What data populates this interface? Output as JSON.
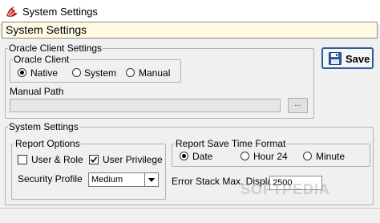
{
  "window": {
    "title": "System Settings",
    "icon": "app-logo-icon"
  },
  "caption": "System Settings",
  "save_button": {
    "label": "Save",
    "icon": "floppy-disk-icon"
  },
  "oracle_client_settings": {
    "legend": "Oracle Client Settings",
    "oracle_client": {
      "legend": "Oracle Client",
      "options": [
        {
          "label": "Native",
          "selected": true
        },
        {
          "label": "System",
          "selected": false
        },
        {
          "label": "Manual",
          "selected": false
        }
      ]
    },
    "manual_path": {
      "label": "Manual Path",
      "value": "",
      "browse_label": "..."
    }
  },
  "system_settings": {
    "legend": "System Settings",
    "report_options": {
      "legend": "Report Options",
      "user_and_role": {
        "label": "User & Role",
        "checked": false
      },
      "user_privilege": {
        "label": "User Privilege",
        "checked": true
      },
      "security_profile": {
        "label": "Security Profile",
        "value": "Medium"
      }
    },
    "report_save_time_format": {
      "legend": "Report Save Time Format",
      "options": [
        {
          "label": "Date",
          "selected": true
        },
        {
          "label": "Hour 24",
          "selected": false
        },
        {
          "label": "Minute",
          "selected": false
        }
      ]
    },
    "error_stack": {
      "label": "Error Stack Max. Display",
      "value": "2500"
    }
  },
  "watermark": "SOFTPEDIA"
}
